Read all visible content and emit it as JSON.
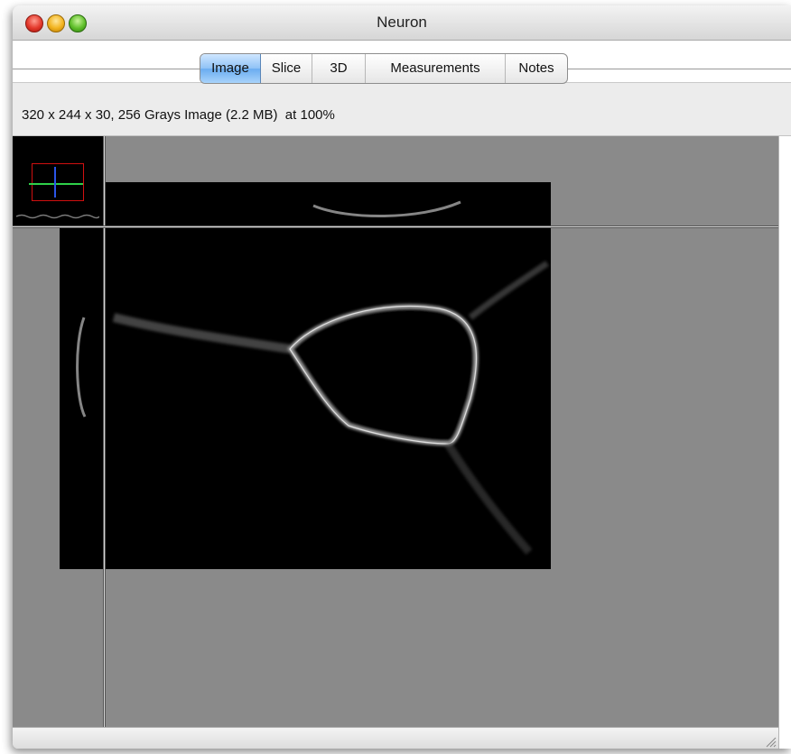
{
  "window": {
    "title": "Neuron"
  },
  "tabs": [
    {
      "label": "Image",
      "selected": true
    },
    {
      "label": "Slice",
      "selected": false
    },
    {
      "label": "3D",
      "selected": false
    },
    {
      "label": "Measurements",
      "selected": false
    },
    {
      "label": "Notes",
      "selected": false
    }
  ],
  "info": {
    "text": "320 x 244 x 30, 256 Grays Image (2.2 MB)  at 100%"
  },
  "colors": {
    "selected_tab": "#8fc2f6",
    "viewer_background": "#8a8a8a",
    "crosshair": "#d6d6d6"
  },
  "icons": [
    "close-icon",
    "minimize-icon",
    "zoom-icon",
    "resize-grip-icon"
  ]
}
